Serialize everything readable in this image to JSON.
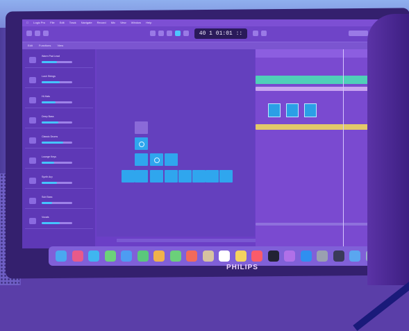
{
  "monitor_brand": "PHILIPS",
  "lcd": {
    "position": "40 1 01:01",
    "suffix": "::"
  },
  "menubar": [
    "Logic Pro",
    "File",
    "Edit",
    "Track",
    "Navigate",
    "Record",
    "Mix",
    "View",
    "Window",
    "?",
    "Help"
  ],
  "tabs": [
    "Edit",
    "Functions",
    "View"
  ],
  "tracks": [
    {
      "name": "Warm Pad Lead",
      "level": 0.5
    },
    {
      "name": "Lush Strings",
      "level": 0.6
    },
    {
      "name": "Hi-Hats",
      "level": 0.45
    },
    {
      "name": "Deep Bass",
      "level": 0.55
    },
    {
      "name": "Classic Drums",
      "level": 0.7
    },
    {
      "name": "Lounge Keys",
      "level": 0.4
    },
    {
      "name": "Synth Arp",
      "level": 0.5
    },
    {
      "name": "Sub Bass",
      "level": 0.35
    },
    {
      "name": "Vocals",
      "level": 0.6
    }
  ],
  "colors": {
    "screen": "#6b3fc6",
    "clip": "#2fa6ee",
    "region_green": "#4fd0b8",
    "region_yellow": "#e2c86a",
    "dock": "#8060d8"
  },
  "dock_icons": [
    "finder-icon",
    "launchpad-icon",
    "safari-icon",
    "messages-icon",
    "mail-icon",
    "maps-icon",
    "photos-icon",
    "facetime-icon",
    "calendar-icon",
    "contacts-icon",
    "reminders-icon",
    "notes-icon",
    "music-icon",
    "appletv-icon",
    "podcasts-icon",
    "appstore-icon",
    "settings-icon",
    "logic-icon",
    "downloads-icon",
    "trash-icon"
  ]
}
